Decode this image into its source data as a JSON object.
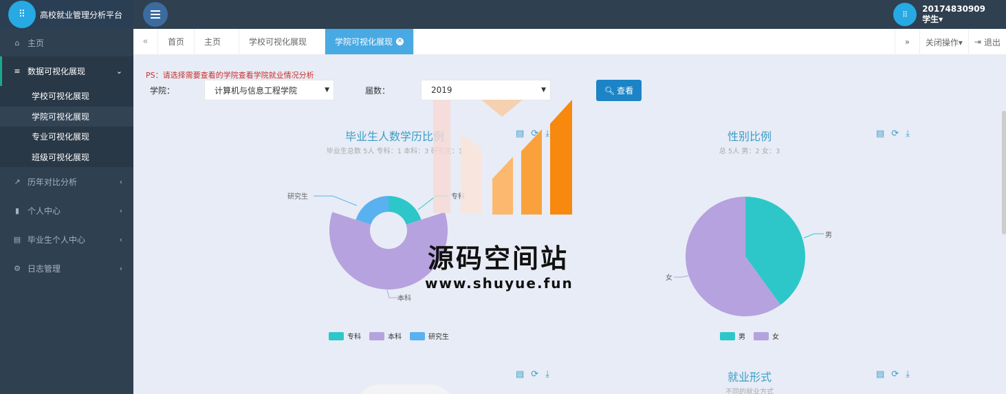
{
  "app": {
    "title": "高校就业管理分析平台"
  },
  "user": {
    "id": "20174830909",
    "role": "学生▾"
  },
  "sidebar": {
    "items": [
      {
        "label": "主页"
      },
      {
        "label": "数据可视化展现"
      },
      {
        "label": "历年对比分析"
      },
      {
        "label": "个人中心"
      },
      {
        "label": "毕业生个人中心"
      },
      {
        "label": "日志管理"
      }
    ],
    "sub": [
      {
        "label": "学校可视化展现"
      },
      {
        "label": "学院可视化展现"
      },
      {
        "label": "专业可视化展现"
      },
      {
        "label": "班级可视化展现"
      }
    ]
  },
  "tabs": {
    "items": [
      {
        "label": "首页"
      },
      {
        "label": "主页"
      },
      {
        "label": "学校可视化展现"
      },
      {
        "label": "学院可视化展现"
      }
    ],
    "close_ops": "关闭操作▾",
    "logout": "退出"
  },
  "filter": {
    "ps": "PS：请选择需要查看的学院查看学院就业情况分析",
    "college_label": "学院：",
    "college_value": "计算机与信息工程学院",
    "year_label": "届数：",
    "year_value": "2019",
    "view_button": "查看"
  },
  "charts": {
    "degree": {
      "title": "毕业生人数学历比例",
      "subtitle": "毕业生总数 5人 专科：1 本科：3 研究生：1",
      "labels": {
        "grad": "研究生",
        "assoc": "专科",
        "bach": "本科"
      },
      "legend": [
        "专科",
        "本科",
        "研究生"
      ]
    },
    "gender": {
      "title": "性别比例",
      "subtitle": "总 5人 男：2 女：3",
      "labels": {
        "male": "男",
        "female": "女"
      },
      "legend": [
        "男",
        "女"
      ]
    },
    "employment": {
      "title": "就业形式",
      "subtitle": "不同的就业方式"
    }
  },
  "chart_data": [
    {
      "type": "pie",
      "title": "毕业生人数学历比例",
      "categories": [
        "专科",
        "本科",
        "研究生"
      ],
      "values": [
        1,
        3,
        1
      ],
      "style": "rose"
    },
    {
      "type": "pie",
      "title": "性别比例",
      "categories": [
        "男",
        "女"
      ],
      "values": [
        2,
        3
      ]
    }
  ],
  "watermark": {
    "text": "源码空间站",
    "url": "www.shuyue.fun"
  },
  "colors": {
    "teal": "#2ec7c9",
    "purple": "#b6a2de",
    "blue": "#5ab1ef",
    "accent": "#1c84c6"
  }
}
